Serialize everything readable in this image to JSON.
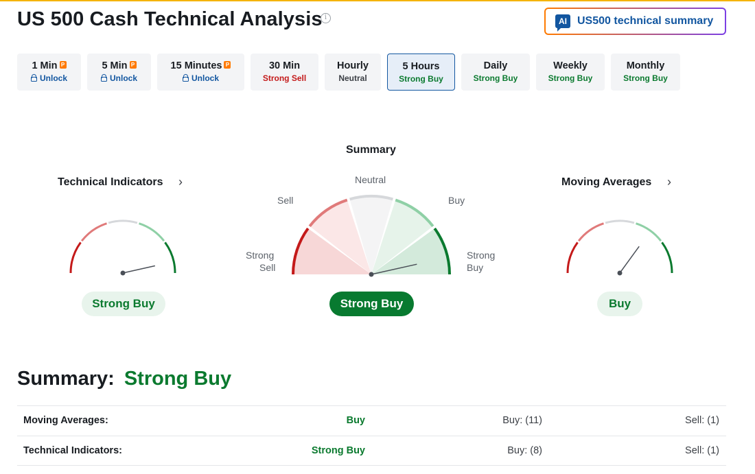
{
  "page": {
    "title": "US 500 Cash Technical Analysis",
    "info_icon": "info-circle-icon",
    "ai_button": {
      "badge": "AI",
      "label": "US500 technical summary"
    }
  },
  "tabs": [
    {
      "label": "1 Min",
      "sub": "Unlock",
      "locked": true,
      "status": "locked"
    },
    {
      "label": "5 Min",
      "sub": "Unlock",
      "locked": true,
      "status": "locked"
    },
    {
      "label": "15 Minutes",
      "sub": "Unlock",
      "locked": true,
      "status": "locked"
    },
    {
      "label": "30 Min",
      "sub": "Strong Sell",
      "locked": false,
      "status": "sell"
    },
    {
      "label": "Hourly",
      "sub": "Neutral",
      "locked": false,
      "status": "neutral"
    },
    {
      "label": "5 Hours",
      "sub": "Strong Buy",
      "locked": false,
      "status": "buy",
      "active": true
    },
    {
      "label": "Daily",
      "sub": "Strong Buy",
      "locked": false,
      "status": "buy"
    },
    {
      "label": "Weekly",
      "sub": "Strong Buy",
      "locked": false,
      "status": "buy"
    },
    {
      "label": "Monthly",
      "sub": "Strong Buy",
      "locked": false,
      "status": "buy"
    }
  ],
  "gauges": {
    "technical": {
      "title": "Technical Indicators",
      "result": "Strong Buy",
      "needle_level": 0.93
    },
    "summary": {
      "title": "Summary",
      "result": "Strong Buy",
      "needle_level": 0.93,
      "labels": {
        "neutral": "Neutral",
        "sell": "Sell",
        "buy": "Buy",
        "strong_sell_1": "Strong",
        "strong_sell_2": "Sell",
        "strong_buy_1": "Strong",
        "strong_buy_2": "Buy"
      }
    },
    "moving": {
      "title": "Moving Averages",
      "result": "Buy",
      "needle_level": 0.7
    }
  },
  "summary": {
    "heading": "Summary:",
    "value": "Strong Buy",
    "rows": [
      {
        "label": "Moving Averages:",
        "signal": "Buy",
        "buy": "Buy: (11)",
        "sell": "Sell: (1)"
      },
      {
        "label": "Technical Indicators:",
        "signal": "Strong Buy",
        "buy": "Buy: (8)",
        "sell": "Sell: (1)"
      }
    ]
  },
  "colors": {
    "strong_sell": "#c41a1a",
    "sell": "#e07a7a",
    "neutral": "#d6d8db",
    "buy": "#8fd0a6",
    "strong_buy": "#0b7a2f",
    "accent": "#1256a0",
    "topline": "#f5b301"
  }
}
